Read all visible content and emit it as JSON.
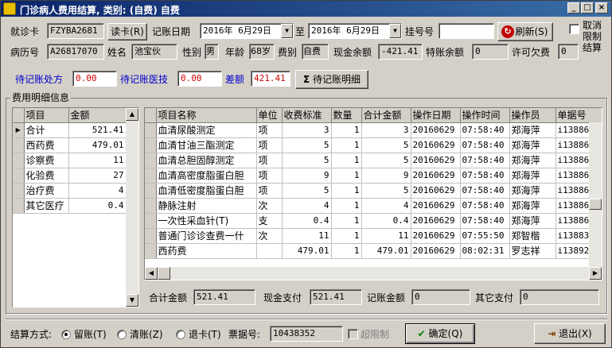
{
  "window": {
    "title": "门诊病人费用结算, 类别: (自费) 自费",
    "controls": [
      "_",
      "□",
      "×"
    ]
  },
  "row1": {
    "visit_label": "就诊卡",
    "visit_value": "FZYBA2681",
    "read_card_btn": "读卡(R)",
    "date_label": "记账日期",
    "date_from": "2016年 6月29日",
    "to_label": "至",
    "date_to": "2016年 6月29日",
    "reg_label": "挂号号",
    "reg_value": "",
    "refresh_btn": "刷新(S)",
    "cancel_limit_label": "取消限制结算"
  },
  "row2": {
    "record_label": "病历号",
    "record_value": "A26817070",
    "name_label": "姓名",
    "name_value": "池宝伙",
    "gender_label": "性别",
    "gender_value": "男",
    "age_label": "年龄",
    "age_value": "68岁",
    "feetype_label": "费别",
    "feetype_value": "自费",
    "cash_label": "现金余额",
    "cash_value": "-421.41",
    "special_label": "特账余额",
    "special_value": "0",
    "allow_label": "许可欠费",
    "allow_value": "0"
  },
  "row3": {
    "pending_rx_label": "待记账处方",
    "pending_rx_value": "0.00",
    "pending_med_label": "待记账医技",
    "pending_med_value": "0.00",
    "diff_label": "差额",
    "diff_value": "421.41",
    "detail_btn": "待记账明细"
  },
  "group_title": "费用明细信息",
  "summary_grid": {
    "columns": [
      "项目",
      "金额"
    ],
    "rows": [
      {
        "item": "合计",
        "amount": "521.41"
      },
      {
        "item": "西药费",
        "amount": "479.01"
      },
      {
        "item": "诊察费",
        "amount": "11"
      },
      {
        "item": "化验费",
        "amount": "27"
      },
      {
        "item": "治疗费",
        "amount": "4"
      },
      {
        "item": "其它医疗",
        "amount": "0.4"
      }
    ]
  },
  "detail_grid": {
    "columns": [
      "项目名称",
      "单位",
      "收费标准",
      "数量",
      "合计金额",
      "操作日期",
      "操作时间",
      "操作员",
      "单据号"
    ],
    "rows": [
      [
        "血清尿酸测定",
        "项",
        "3",
        "1",
        "3",
        "20160629",
        "07:58:40",
        "郑海萍",
        "i13886"
      ],
      [
        "血清甘油三酯测定",
        "项",
        "5",
        "1",
        "5",
        "20160629",
        "07:58:40",
        "郑海萍",
        "i13886"
      ],
      [
        "血清总胆固醇测定",
        "项",
        "5",
        "1",
        "5",
        "20160629",
        "07:58:40",
        "郑海萍",
        "i13886"
      ],
      [
        "血清高密度脂蛋白胆",
        "项",
        "9",
        "1",
        "9",
        "20160629",
        "07:58:40",
        "郑海萍",
        "i13886"
      ],
      [
        "血清低密度脂蛋白胆",
        "项",
        "5",
        "1",
        "5",
        "20160629",
        "07:58:40",
        "郑海萍",
        "i13886"
      ],
      [
        "静脉注射",
        "次",
        "4",
        "1",
        "4",
        "20160629",
        "07:58:40",
        "郑海萍",
        "i13886"
      ],
      [
        "一次性采血针(T)",
        "支",
        "0.4",
        "1",
        "0.4",
        "20160629",
        "07:58:40",
        "郑海萍",
        "i13886"
      ],
      [
        "普通门诊诊查费一什",
        "次",
        "11",
        "1",
        "11",
        "20160629",
        "07:55:50",
        "郑智楷",
        "i13883"
      ],
      [
        "西药费",
        "",
        "479.01",
        "1",
        "479.01",
        "20160629",
        "08:02:31",
        "罗志祥",
        "i13892"
      ]
    ]
  },
  "totals": {
    "total_label": "合计金额",
    "total_value": "521.41",
    "cash_pay_label": "现金支付",
    "cash_pay_value": "521.41",
    "account_label": "记账金额",
    "account_value": "0",
    "other_label": "其它支付",
    "other_value": "0"
  },
  "footer": {
    "method_label": "结算方式:",
    "opt_stay": "留账(T)",
    "opt_clear": "清账(Z)",
    "opt_refund": "退卡(T)",
    "ticket_label": "票据号:",
    "ticket_value": "10438352",
    "over_limit_label": "超限制",
    "ok_btn": "确定(Q)",
    "exit_btn": "退出(X)"
  },
  "colors": {
    "title_start": "#0a246a",
    "title_end": "#3a6ea5",
    "face": "#d4d0c8",
    "accent_red": "#d00000",
    "label_blue": "#0000cc"
  }
}
